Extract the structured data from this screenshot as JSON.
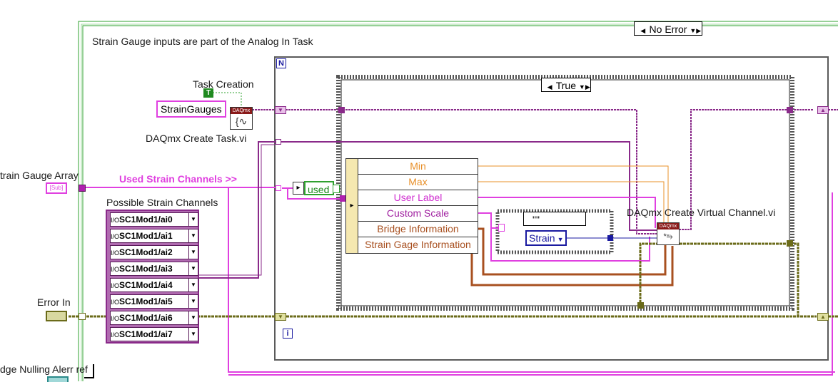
{
  "top_selector": {
    "value": "No Error"
  },
  "comment": "Strain Gauge inputs are part of the Analog In Task",
  "task_creation": {
    "label": "Task Creation",
    "bool_const": "T"
  },
  "strain_gauges_const": "StrainGauges",
  "create_task_vi": {
    "label": "DAQmx Create Task.vi",
    "header": "DAQmx"
  },
  "strain_gauge_array": {
    "label": "train Gauge Array",
    "terminal_text": "[Sub]"
  },
  "used_strain_channels": "Used Strain Channels >>",
  "possible_strain_channels": {
    "label": "Possible Strain Channels",
    "channels": [
      "SC1Mod1/ai0",
      "SC1Mod1/ai1",
      "SC1Mod1/ai2",
      "SC1Mod1/ai3",
      "SC1Mod1/ai4",
      "SC1Mod1/ai5",
      "SC1Mod1/ai6",
      "SC1Mod1/ai7"
    ],
    "io_glyph": "I/O"
  },
  "error_in": {
    "label": "Error In"
  },
  "bridge_nulling": {
    "label": "dge Nulling Alerr ref"
  },
  "for_loop": {
    "count_terminal": "N",
    "index_terminal": "i"
  },
  "case_structure": {
    "selector": "True"
  },
  "used_indicator": "used",
  "unbundle": {
    "items": [
      {
        "label": "Min",
        "color": "#e8902a"
      },
      {
        "label": "Max",
        "color": "#e8902a"
      },
      {
        "label": "User Label",
        "color": "#d030d0"
      },
      {
        "label": "Custom Scale",
        "color": "#a020a0"
      },
      {
        "label": "Bridge Information",
        "color": "#a85020"
      },
      {
        "label": "Strain Gage Information",
        "color": "#a85020"
      }
    ]
  },
  "inner_case": {
    "selector": "\"\""
  },
  "strain_ring": "Strain",
  "create_channel_vi": {
    "label": "DAQmx Create Virtual Channel.vi",
    "header": "DAQmx"
  },
  "colors": {
    "loop_green": "#2fa02f",
    "string_pink": "#e040e0",
    "cluster_purple": "#8a2a8a",
    "error_olive": "#6b6b1a",
    "numeric_orange": "#e8902a",
    "enum_blue": "#1a1aa0"
  }
}
